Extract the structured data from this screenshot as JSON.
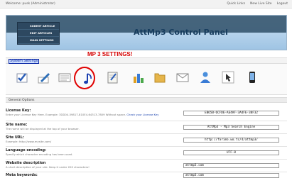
{
  "topbar": {
    "welcome": "Welcome: pusk (Administrator)",
    "links": [
      "Quick Links",
      "New Live Site",
      "Logout"
    ]
  },
  "header": {
    "menu": [
      "SUBMIT ARTICLE",
      "EDIT ARTICLES",
      "MAIN SETTINGS"
    ],
    "title": "AttMp3 Control Panel"
  },
  "annotation": "MP 3 SETTINGS!",
  "system_link": "System Settings",
  "icons": [
    "settings-check-icon",
    "edit-pencil-icon",
    "notepad-icon",
    "music-note-icon",
    "clipboard-icon",
    "bar-chart-icon",
    "folder-icon",
    "mail-icon",
    "users-icon",
    "cursor-hand-icon",
    "phone-icon"
  ],
  "general": {
    "title": "General Options",
    "rows": [
      {
        "label": "License Key:",
        "desc": "Enter your License Key Here. Example: 3DD04-59817-810E4-64313-7809 Without space.",
        "desc_link": "Check your License Key",
        "value": "EB65B-6CFDE-AE4AF-3A4FE-38F32"
      },
      {
        "label": "Site name:",
        "desc": "The name will be displayed at the top of your browser.",
        "value": "AttMp3 - Mp3 Search Engine"
      },
      {
        "label": "Site URL:",
        "desc": "Example: http://www.mysite.com/",
        "value": "http://farimo.wo.tc/4/attmp3/"
      },
      {
        "label": "Language encoding:",
        "desc": "Specify which character encoding has been used.",
        "value": "UTF-8"
      },
      {
        "label": "Website description",
        "desc": "A short description of your site. Keep it under 200 characters!",
        "value": "attmp3.com"
      },
      {
        "label": "Meta keywords:",
        "desc": "",
        "value": "attmp3.com"
      }
    ]
  },
  "colors": {
    "header_top": "#36576f",
    "header_bottom": "#9fc4e4",
    "annotation": "#d60000",
    "link": "#0b28a6"
  }
}
